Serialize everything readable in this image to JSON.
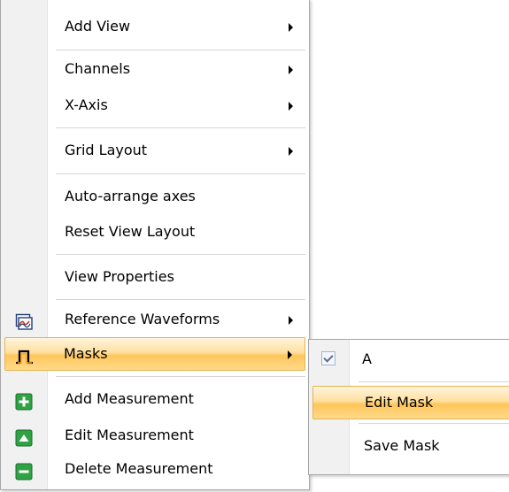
{
  "context_menu": {
    "items": [
      {
        "label": "Add View",
        "submenu": true
      },
      {
        "label": "Channels",
        "submenu": true
      },
      {
        "label": "X-Axis",
        "submenu": true
      },
      {
        "label": "Grid Layout",
        "submenu": true
      },
      {
        "label": "Auto-arrange axes",
        "submenu": false
      },
      {
        "label": "Reset View Layout",
        "submenu": false
      },
      {
        "label": "View Properties",
        "submenu": false
      },
      {
        "label": "Reference Waveforms",
        "submenu": true,
        "icon": "reference-waveform-icon"
      },
      {
        "label": "Masks",
        "submenu": true,
        "icon": "mask-pulse-icon",
        "highlighted": true
      },
      {
        "label": "Add Measurement",
        "submenu": false,
        "icon": "add-measurement-icon"
      },
      {
        "label": "Edit Measurement",
        "submenu": false,
        "icon": "edit-measurement-icon"
      },
      {
        "label": "Delete Measurement",
        "submenu": false,
        "icon": "delete-measurement-icon"
      }
    ]
  },
  "masks_submenu": {
    "items": [
      {
        "label": "A",
        "checked": true
      },
      {
        "label": "Edit Mask",
        "highlighted": true
      },
      {
        "label": "Save Mask"
      }
    ]
  },
  "colors": {
    "highlight": "#ffc65a",
    "icon_green": "#2fa344",
    "icon_green_dark": "#1d6b2c",
    "mask_orange": "#f0a11e"
  }
}
